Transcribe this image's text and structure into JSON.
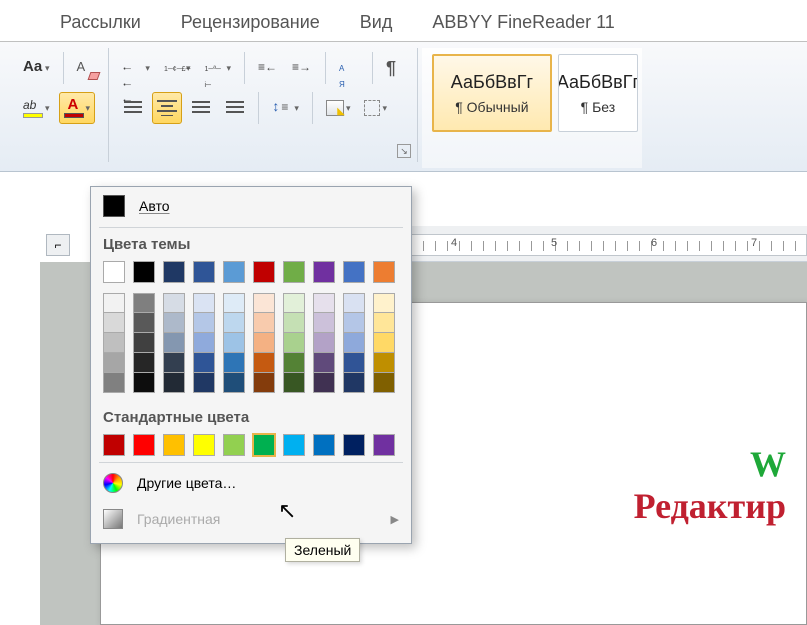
{
  "tabs": {
    "mailings": "Рассылки",
    "review": "Рецензирование",
    "view": "Вид",
    "abbyy": "ABBYY FineReader 11"
  },
  "dropdown": {
    "auto": "Авто",
    "theme_label": "Цвета темы",
    "standard_label": "Стандартные цвета",
    "more_colors": "Другие цвета…",
    "gradient": "Градиентная",
    "tooltip": "Зеленый",
    "theme_top": [
      "#ffffff",
      "#000000",
      "#1f3864",
      "#2f5597",
      "#5b9bd5",
      "#c00000",
      "#70ad47",
      "#7030a0",
      "#4472c4",
      "#ed7d31"
    ],
    "shade_cols": [
      [
        "#f2f2f2",
        "#d9d9d9",
        "#bfbfbf",
        "#a6a6a6",
        "#808080"
      ],
      [
        "#7f7f7f",
        "#595959",
        "#404040",
        "#262626",
        "#0d0d0d"
      ],
      [
        "#d6dce5",
        "#adb9ca",
        "#8497b0",
        "#333f50",
        "#222a35"
      ],
      [
        "#dae3f3",
        "#b4c7e7",
        "#8faadc",
        "#2f5597",
        "#203864"
      ],
      [
        "#deebf7",
        "#bdd7ee",
        "#9dc3e6",
        "#2e75b6",
        "#1f4e79"
      ],
      [
        "#fbe5d6",
        "#f8cbad",
        "#f4b183",
        "#c55a11",
        "#843c0c"
      ],
      [
        "#e2f0d9",
        "#c5e0b4",
        "#a9d18e",
        "#548235",
        "#385723"
      ],
      [
        "#e6e0ec",
        "#ccc1da",
        "#b3a2c7",
        "#604a7b",
        "#403152"
      ],
      [
        "#d9e1f2",
        "#b4c6e7",
        "#8ea9db",
        "#305496",
        "#203764"
      ],
      [
        "#fff2cc",
        "#ffe699",
        "#ffd966",
        "#bf8f00",
        "#806000"
      ]
    ],
    "standard": [
      "#c00000",
      "#ff0000",
      "#ffc000",
      "#ffff00",
      "#92d050",
      "#00b050",
      "#00b0f0",
      "#0070c0",
      "#002060",
      "#7030a0"
    ],
    "standard_selected_index": 5
  },
  "styles": {
    "preview": "АаБбВвГг",
    "normal": "¶ Обычный",
    "nospacing": "¶ Без"
  },
  "ruler": {
    "n4": "4",
    "n5": "5",
    "n6": "6",
    "n7": "7"
  },
  "doc": {
    "line1": "W",
    "line2": "Редактир"
  }
}
